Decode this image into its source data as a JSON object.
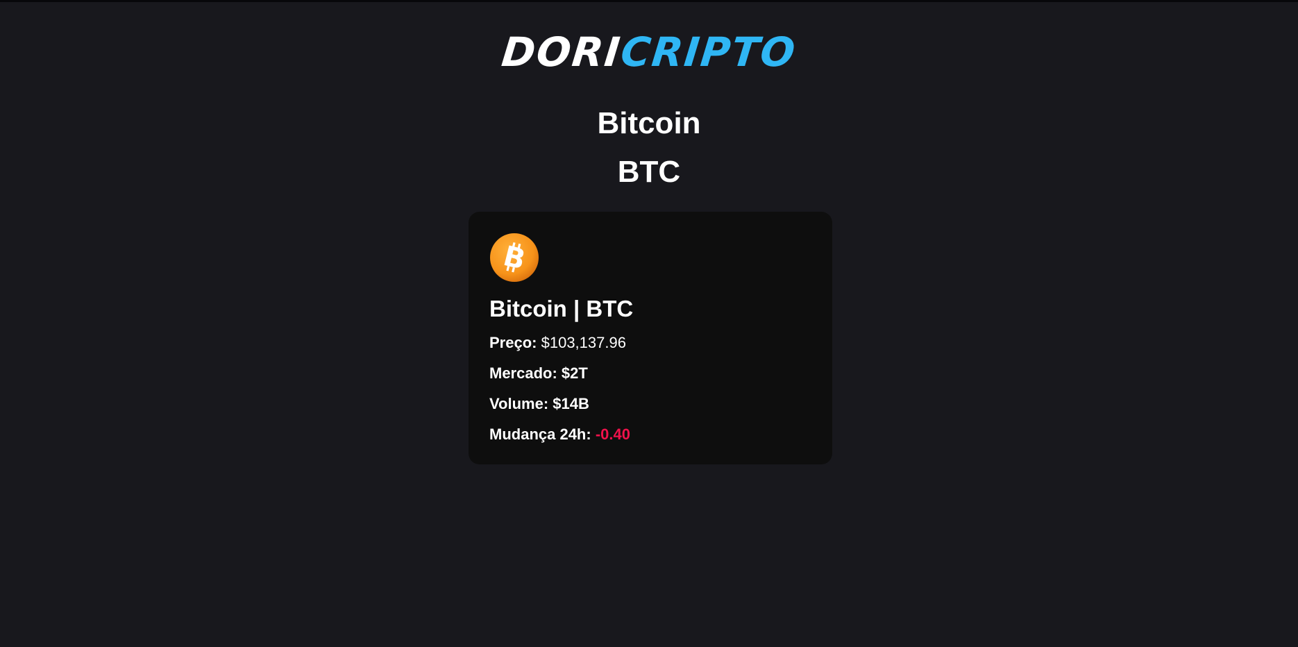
{
  "logo": {
    "part1": "DORI",
    "part2": "CRIPTO",
    "color_primary": "#ffffff",
    "color_accent": "#2fb6f4"
  },
  "header": {
    "name": "Bitcoin",
    "symbol": "BTC"
  },
  "card": {
    "icon": "bitcoin-icon",
    "title": "Bitcoin | BTC",
    "price_label": "Preço:",
    "price_value": "$103,137.96",
    "market_label": "Mercado:",
    "market_value": "$2T",
    "volume_label": "Volume:",
    "volume_value": "$14B",
    "change_label": "Mudança 24h:",
    "change_value": "-0.40",
    "change_color": "#f0124b",
    "background": "#0e0e0e"
  },
  "page": {
    "background": "#18181d"
  }
}
